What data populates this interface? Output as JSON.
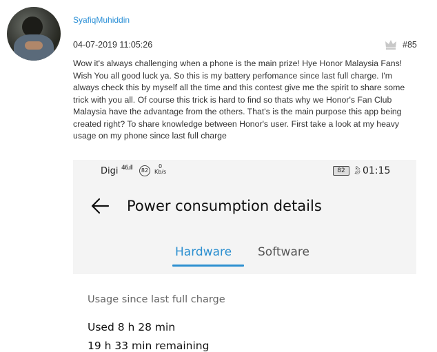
{
  "post": {
    "username": "SyafiqMuhiddin",
    "date": "04-07-2019 11:05:26",
    "floor": "#85",
    "body": "Wow it's always challenging when a phone is the main prize! Hye Honor Malaysia Fans! Wish You all good luck ya. So this is my battery perfomance since last full charge. I'm always check this by myself all the time and this contest give me the spirit to share some trick with you all. Of course this trick is hard to find so thats why we Honor's Fan Club Malaysia have the advantage from the others. That's is the main purpose this app being created right? To share knowledge between Honor's user. First take a look at my heavy usage on my phone since last full charge"
  },
  "icons": {
    "crown": "crown-icon",
    "back": "back-arrow-icon",
    "avatar": "user-avatar"
  },
  "colors": {
    "link": "#2a8fd6",
    "tab_active": "#2b8fd0"
  },
  "screenshot": {
    "status": {
      "carrier": "Digi",
      "signal": "46.ıll",
      "notification_count": "82",
      "net_speed_value": "0",
      "net_speed_unit": "Kb/s",
      "battery": "82",
      "time": "01:15"
    },
    "title": "Power consumption details",
    "tabs": {
      "hardware": "Hardware",
      "software": "Software"
    },
    "usage_label": "Usage since last full charge",
    "used": "Used 8 h 28 min",
    "remaining": "19 h 33 min remaining"
  }
}
